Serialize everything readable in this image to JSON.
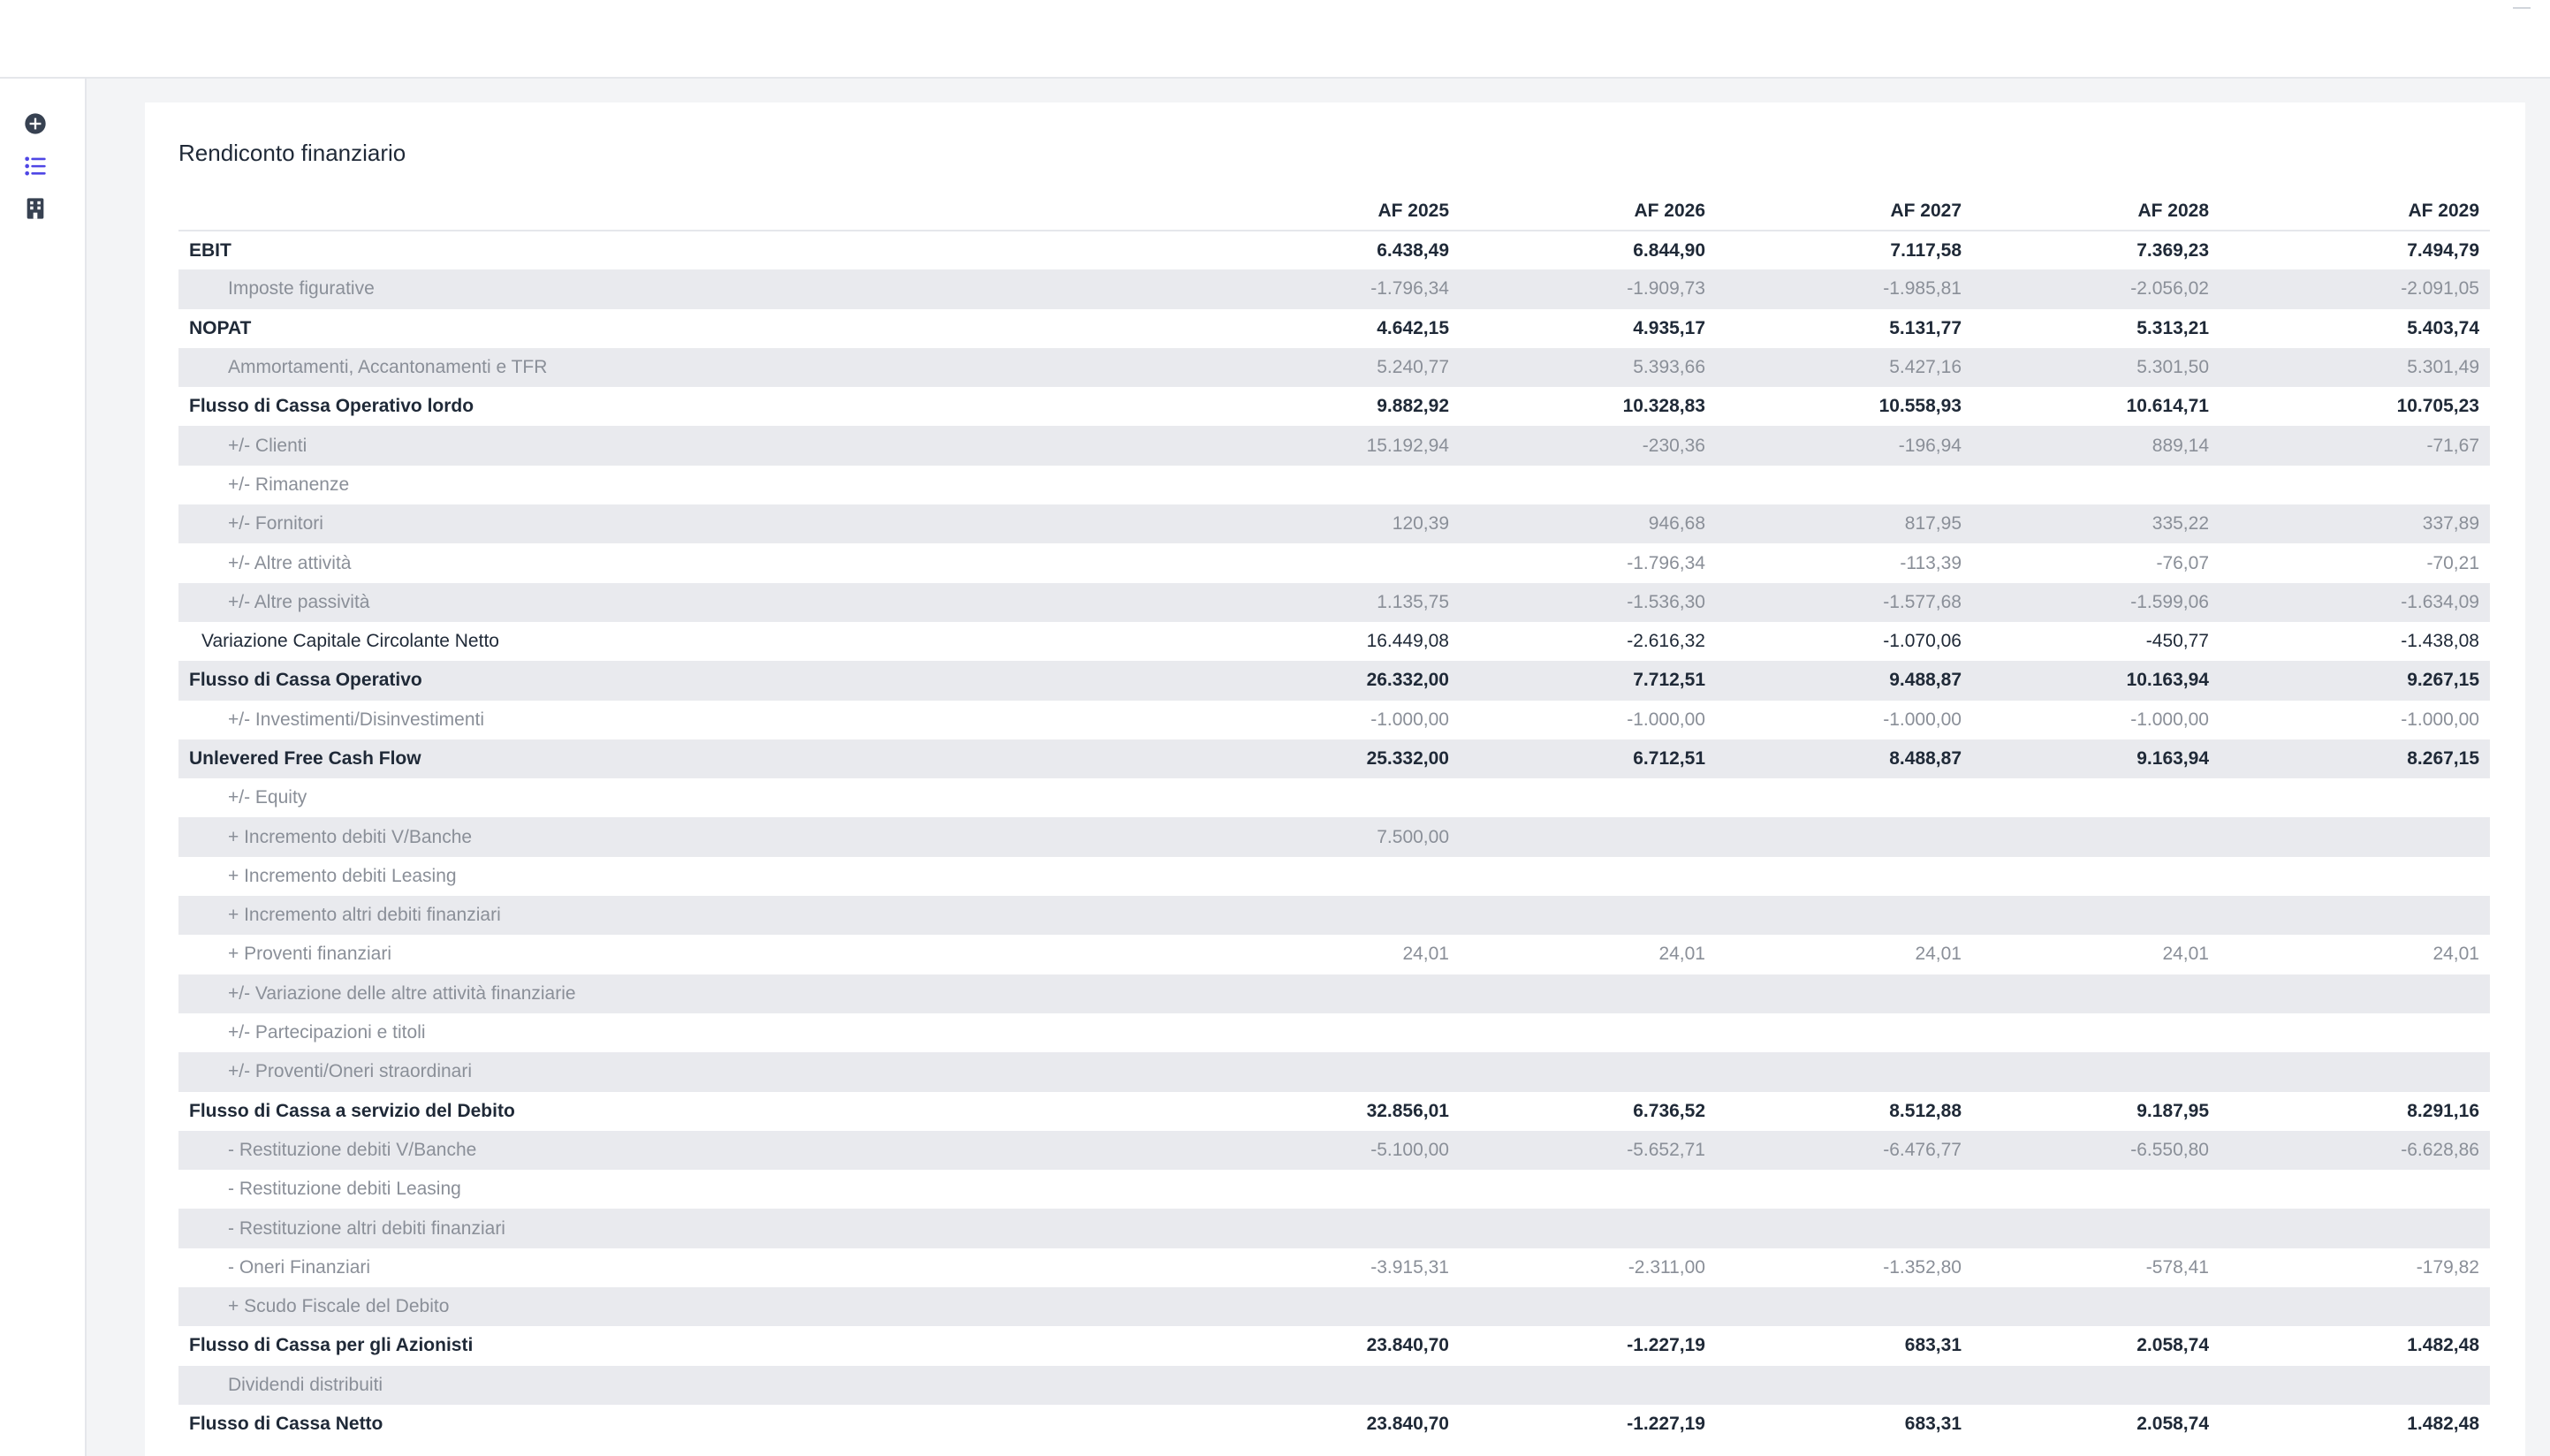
{
  "sidebar": {
    "items": [
      {
        "icon": "plus-circle-icon"
      },
      {
        "icon": "list-icon"
      },
      {
        "icon": "building-icon"
      }
    ],
    "active_color": "#4f46e5",
    "icon_color": "#374151"
  },
  "report": {
    "title": "Rendiconto finanziario",
    "columns": [
      "AF 2025",
      "AF 2026",
      "AF 2027",
      "AF 2028",
      "AF 2029"
    ],
    "rows": [
      {
        "label": "EBIT",
        "level": "total",
        "values": [
          "6.438,49",
          "6.844,90",
          "7.117,58",
          "7.369,23",
          "7.494,79"
        ]
      },
      {
        "label": "Imposte figurative",
        "level": "detail",
        "values": [
          "-1.796,34",
          "-1.909,73",
          "-1.985,81",
          "-2.056,02",
          "-2.091,05"
        ]
      },
      {
        "label": "NOPAT",
        "level": "total",
        "values": [
          "4.642,15",
          "4.935,17",
          "5.131,77",
          "5.313,21",
          "5.403,74"
        ]
      },
      {
        "label": "Ammortamenti, Accantonamenti e TFR",
        "level": "detail",
        "values": [
          "5.240,77",
          "5.393,66",
          "5.427,16",
          "5.301,50",
          "5.301,49"
        ]
      },
      {
        "label": "Flusso di Cassa Operativo lordo",
        "level": "total",
        "values": [
          "9.882,92",
          "10.328,83",
          "10.558,93",
          "10.614,71",
          "10.705,23"
        ]
      },
      {
        "label": "+/- Clienti",
        "level": "detail",
        "values": [
          "15.192,94",
          "-230,36",
          "-196,94",
          "889,14",
          "-71,67"
        ]
      },
      {
        "label": "+/- Rimanenze",
        "level": "detail",
        "values": [
          "",
          "",
          "",
          "",
          ""
        ]
      },
      {
        "label": "+/- Fornitori",
        "level": "detail",
        "values": [
          "120,39",
          "946,68",
          "817,95",
          "335,22",
          "337,89"
        ]
      },
      {
        "label": "+/- Altre attività",
        "level": "detail",
        "values": [
          "",
          "-1.796,34",
          "-113,39",
          "-76,07",
          "-70,21"
        ]
      },
      {
        "label": "+/- Altre passività",
        "level": "detail",
        "values": [
          "1.135,75",
          "-1.536,30",
          "-1.577,68",
          "-1.599,06",
          "-1.634,09"
        ]
      },
      {
        "label": "Variazione Capitale Circolante Netto",
        "level": "sub",
        "values": [
          "16.449,08",
          "-2.616,32",
          "-1.070,06",
          "-450,77",
          "-1.438,08"
        ]
      },
      {
        "label": "Flusso di Cassa Operativo",
        "level": "total",
        "values": [
          "26.332,00",
          "7.712,51",
          "9.488,87",
          "10.163,94",
          "9.267,15"
        ]
      },
      {
        "label": "+/- Investimenti/Disinvestimenti",
        "level": "detail",
        "values": [
          "-1.000,00",
          "-1.000,00",
          "-1.000,00",
          "-1.000,00",
          "-1.000,00"
        ]
      },
      {
        "label": "Unlevered Free Cash Flow",
        "level": "total",
        "values": [
          "25.332,00",
          "6.712,51",
          "8.488,87",
          "9.163,94",
          "8.267,15"
        ]
      },
      {
        "label": "+/- Equity",
        "level": "detail",
        "values": [
          "",
          "",
          "",
          "",
          ""
        ]
      },
      {
        "label": "+ Incremento debiti V/Banche",
        "level": "detail",
        "values": [
          "7.500,00",
          "",
          "",
          "",
          ""
        ]
      },
      {
        "label": "+ Incremento debiti Leasing",
        "level": "detail",
        "values": [
          "",
          "",
          "",
          "",
          ""
        ]
      },
      {
        "label": "+ Incremento altri debiti finanziari",
        "level": "detail",
        "values": [
          "",
          "",
          "",
          "",
          ""
        ]
      },
      {
        "label": "+ Proventi finanziari",
        "level": "detail",
        "values": [
          "24,01",
          "24,01",
          "24,01",
          "24,01",
          "24,01"
        ]
      },
      {
        "label": "+/- Variazione delle altre attività finanziarie",
        "level": "detail",
        "values": [
          "",
          "",
          "",
          "",
          ""
        ]
      },
      {
        "label": "+/- Partecipazioni e titoli",
        "level": "detail",
        "values": [
          "",
          "",
          "",
          "",
          ""
        ]
      },
      {
        "label": "+/- Proventi/Oneri straordinari",
        "level": "detail",
        "values": [
          "",
          "",
          "",
          "",
          ""
        ]
      },
      {
        "label": "Flusso di Cassa a servizio del Debito",
        "level": "total",
        "values": [
          "32.856,01",
          "6.736,52",
          "8.512,88",
          "9.187,95",
          "8.291,16"
        ]
      },
      {
        "label": "- Restituzione debiti V/Banche",
        "level": "detail",
        "values": [
          "-5.100,00",
          "-5.652,71",
          "-6.476,77",
          "-6.550,80",
          "-6.628,86"
        ]
      },
      {
        "label": "- Restituzione debiti Leasing",
        "level": "detail",
        "values": [
          "",
          "",
          "",
          "",
          ""
        ]
      },
      {
        "label": "- Restituzione altri debiti finanziari",
        "level": "detail",
        "values": [
          "",
          "",
          "",
          "",
          ""
        ]
      },
      {
        "label": "- Oneri Finanziari",
        "level": "detail",
        "values": [
          "-3.915,31",
          "-2.311,00",
          "-1.352,80",
          "-578,41",
          "-179,82"
        ]
      },
      {
        "label": "+ Scudo Fiscale del Debito",
        "level": "detail",
        "values": [
          "",
          "",
          "",
          "",
          ""
        ]
      },
      {
        "label": "Flusso di Cassa per gli Azionisti",
        "level": "total",
        "values": [
          "23.840,70",
          "-1.227,19",
          "683,31",
          "2.058,74",
          "1.482,48"
        ]
      },
      {
        "label": "Dividendi distribuiti",
        "level": "detail",
        "values": [
          "",
          "",
          "",
          "",
          ""
        ]
      },
      {
        "label": "Flusso di Cassa Netto",
        "level": "total",
        "values": [
          "23.840,70",
          "-1.227,19",
          "683,31",
          "2.058,74",
          "1.482,48"
        ]
      }
    ]
  }
}
